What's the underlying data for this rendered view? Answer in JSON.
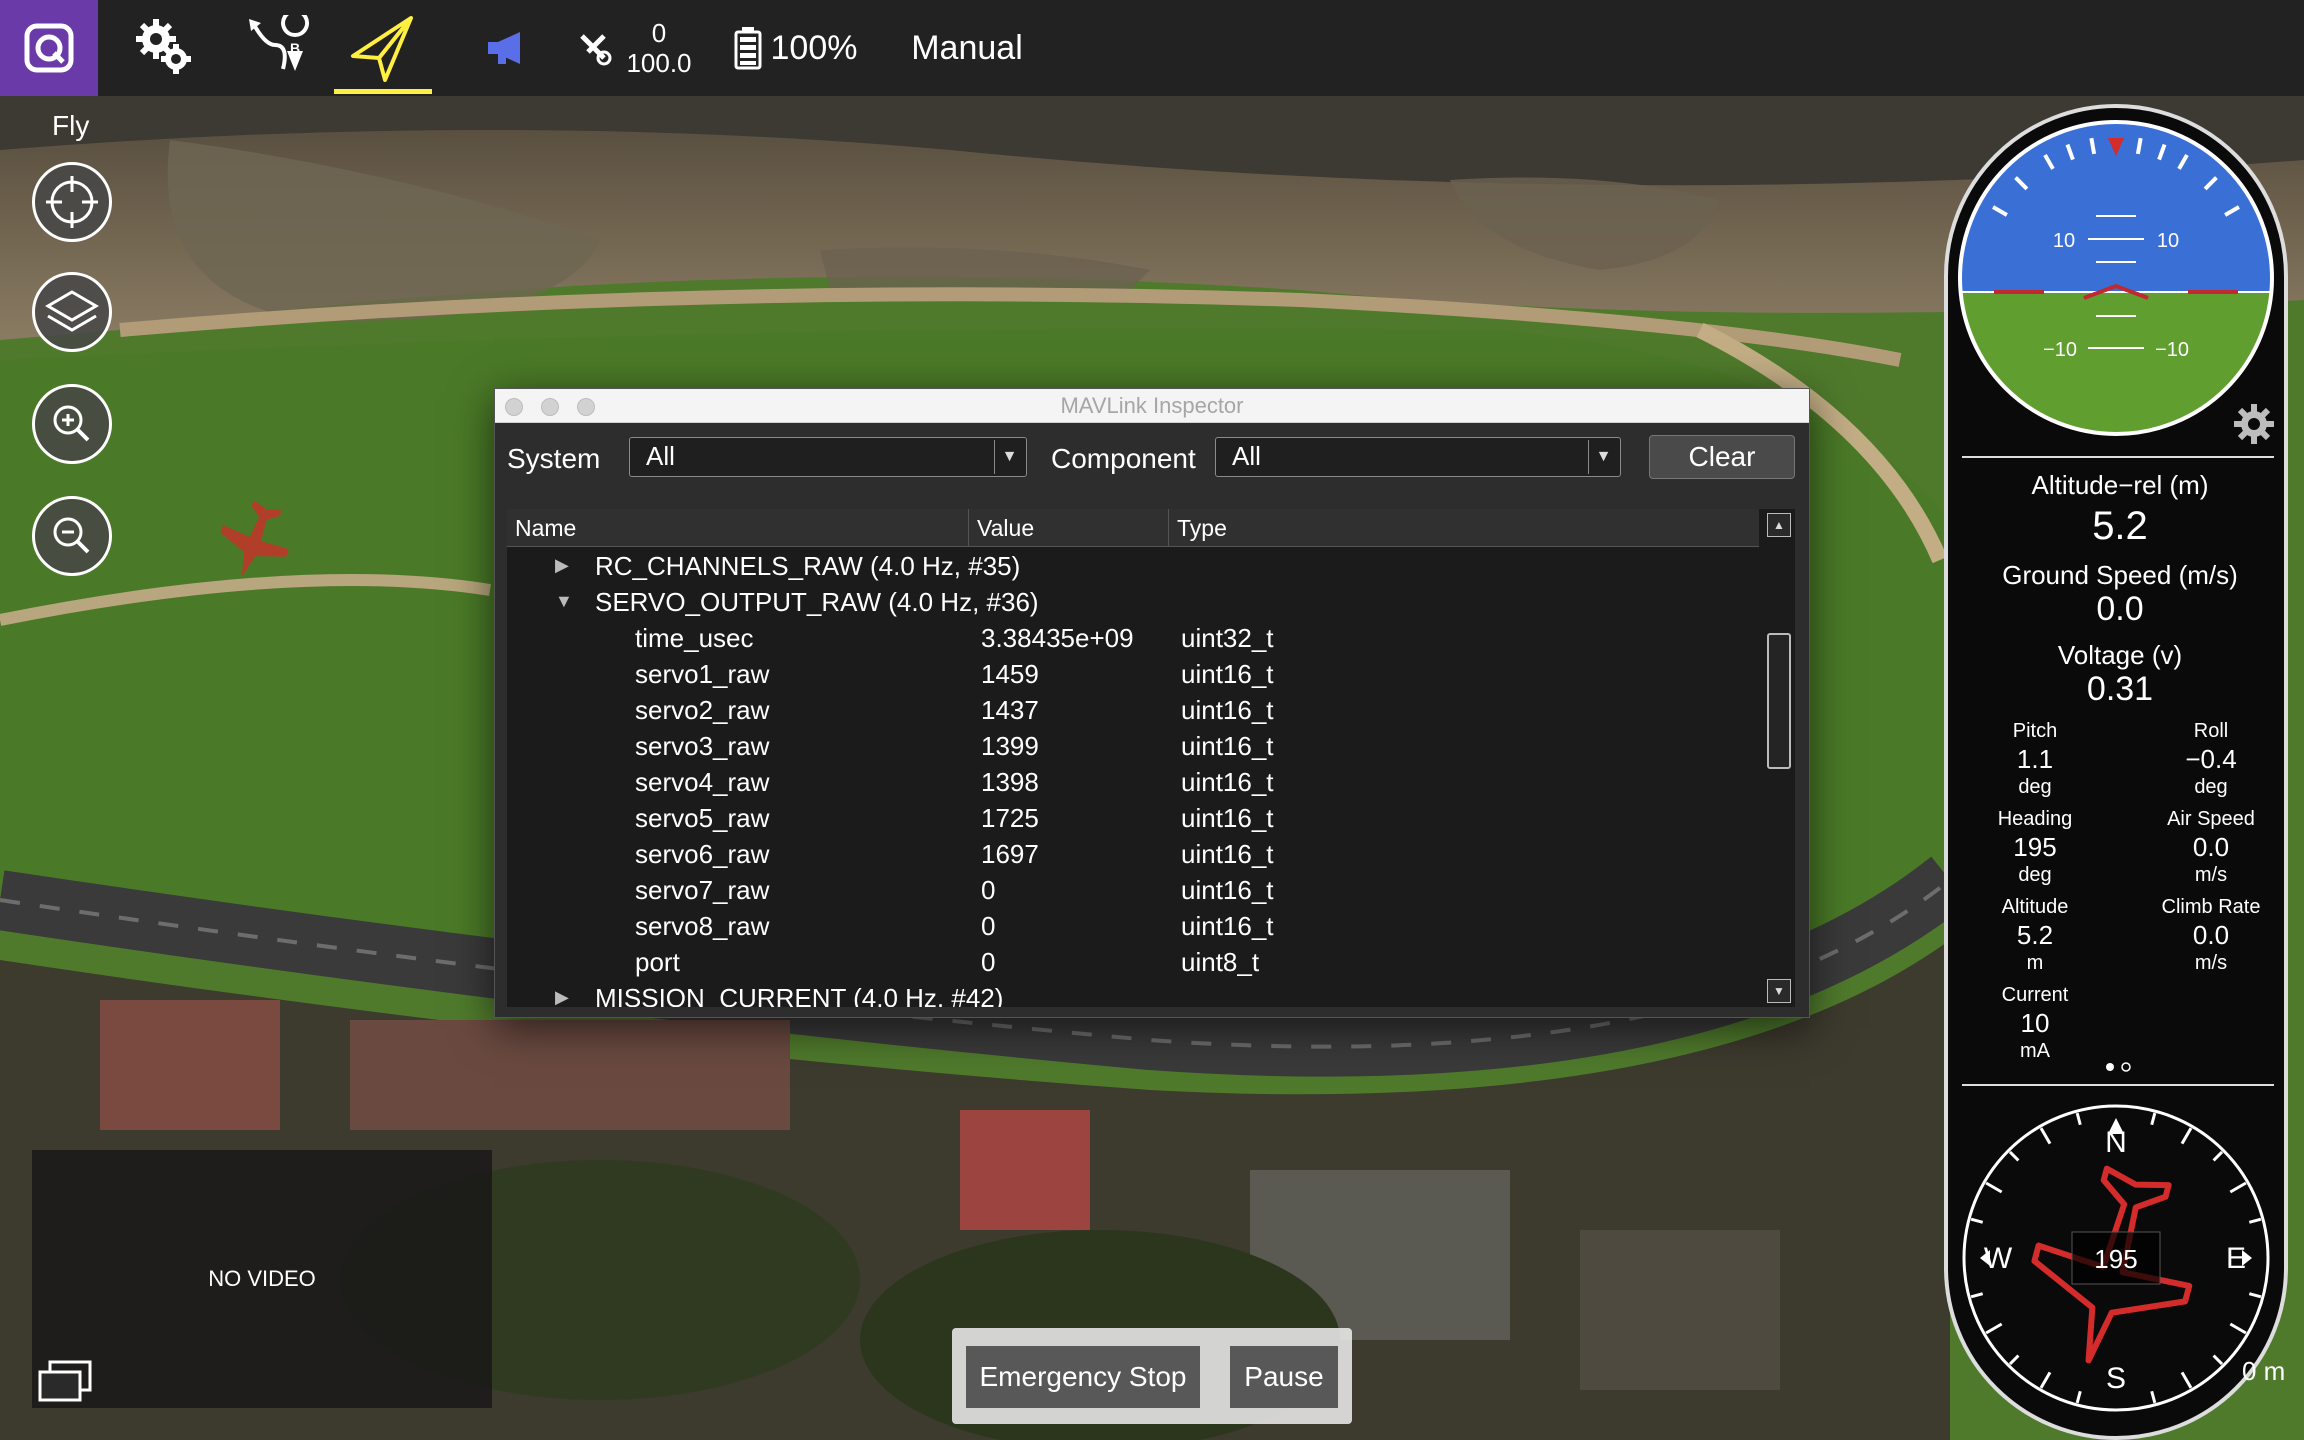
{
  "toolbar": {
    "rc_value": "0",
    "rc_value2": "100.0",
    "battery": "100%",
    "flight_mode": "Manual"
  },
  "fly_view": {
    "label": "Fly",
    "video": "NO VIDEO",
    "emergency_stop": "Emergency Stop",
    "pause": "Pause",
    "scale_text": "0 m"
  },
  "attitude": {
    "ladder_up_left": "10",
    "ladder_up_right": "10",
    "ladder_down_left": "−10",
    "ladder_down_right": "−10"
  },
  "values": {
    "altitude_rel_label": "Altitude−rel (m)",
    "altitude_rel": "5.2",
    "ground_speed_label": "Ground Speed (m/s)",
    "ground_speed": "0.0",
    "voltage_label": "Voltage (v)",
    "voltage": "0.31",
    "grid": [
      {
        "title": "Pitch",
        "value": "1.1",
        "unit": "deg"
      },
      {
        "title": "Roll",
        "value": "−0.4",
        "unit": "deg"
      },
      {
        "title": "Heading",
        "value": "195",
        "unit": "deg"
      },
      {
        "title": "Air Speed",
        "value": "0.0",
        "unit": "m/s"
      },
      {
        "title": "Altitude",
        "value": "5.2",
        "unit": "m"
      },
      {
        "title": "Climb Rate",
        "value": "0.0",
        "unit": "m/s"
      },
      {
        "title": "Current",
        "value": "10",
        "unit": "mA"
      }
    ]
  },
  "compass": {
    "n": "N",
    "s": "S",
    "e": "E",
    "w": "W",
    "heading": "195"
  },
  "inspector": {
    "title": "MAVLink Inspector",
    "system_label": "System",
    "system_value": "All",
    "component_label": "Component",
    "component_value": "All",
    "clear": "Clear",
    "columns": [
      "Name",
      "Value",
      "Type"
    ],
    "rows": [
      {
        "kind": "msg",
        "expanded": false,
        "name": "RC_CHANNELS_RAW (4.0 Hz, #35)",
        "value": "",
        "type": ""
      },
      {
        "kind": "msg",
        "expanded": true,
        "name": "SERVO_OUTPUT_RAW (4.0 Hz, #36)",
        "value": "",
        "type": ""
      },
      {
        "kind": "field",
        "name": "time_usec",
        "value": "3.38435e+09",
        "type": "uint32_t"
      },
      {
        "kind": "field",
        "name": "servo1_raw",
        "value": "1459",
        "type": "uint16_t"
      },
      {
        "kind": "field",
        "name": "servo2_raw",
        "value": "1437",
        "type": "uint16_t"
      },
      {
        "kind": "field",
        "name": "servo3_raw",
        "value": "1399",
        "type": "uint16_t"
      },
      {
        "kind": "field",
        "name": "servo4_raw",
        "value": "1398",
        "type": "uint16_t"
      },
      {
        "kind": "field",
        "name": "servo5_raw",
        "value": "1725",
        "type": "uint16_t"
      },
      {
        "kind": "field",
        "name": "servo6_raw",
        "value": "1697",
        "type": "uint16_t"
      },
      {
        "kind": "field",
        "name": "servo7_raw",
        "value": "0",
        "type": "uint16_t"
      },
      {
        "kind": "field",
        "name": "servo8_raw",
        "value": "0",
        "type": "uint16_t"
      },
      {
        "kind": "field",
        "name": "port",
        "value": "0",
        "type": "uint8_t"
      },
      {
        "kind": "msg",
        "expanded": false,
        "name": "MISSION_CURRENT (4.0 Hz, #42)",
        "value": "",
        "type": ""
      }
    ]
  },
  "colors": {
    "accent_yellow": "#ffef40",
    "logo_purple": "#6a3aa8",
    "sky": "#3a6fd6",
    "ground": "#5f9e2f",
    "horizon_red": "#c0292f",
    "vehicle_red": "#d42b2b"
  },
  "icons": [
    "qgc-logo-icon",
    "gear-icon",
    "plan-icon",
    "fly-icon",
    "megaphone-icon",
    "rc-icon",
    "battery-icon",
    "center-icon",
    "layers-icon",
    "zoom-in-icon",
    "zoom-out-icon",
    "swap-icon",
    "settings-icon",
    "vehicle-icon"
  ]
}
